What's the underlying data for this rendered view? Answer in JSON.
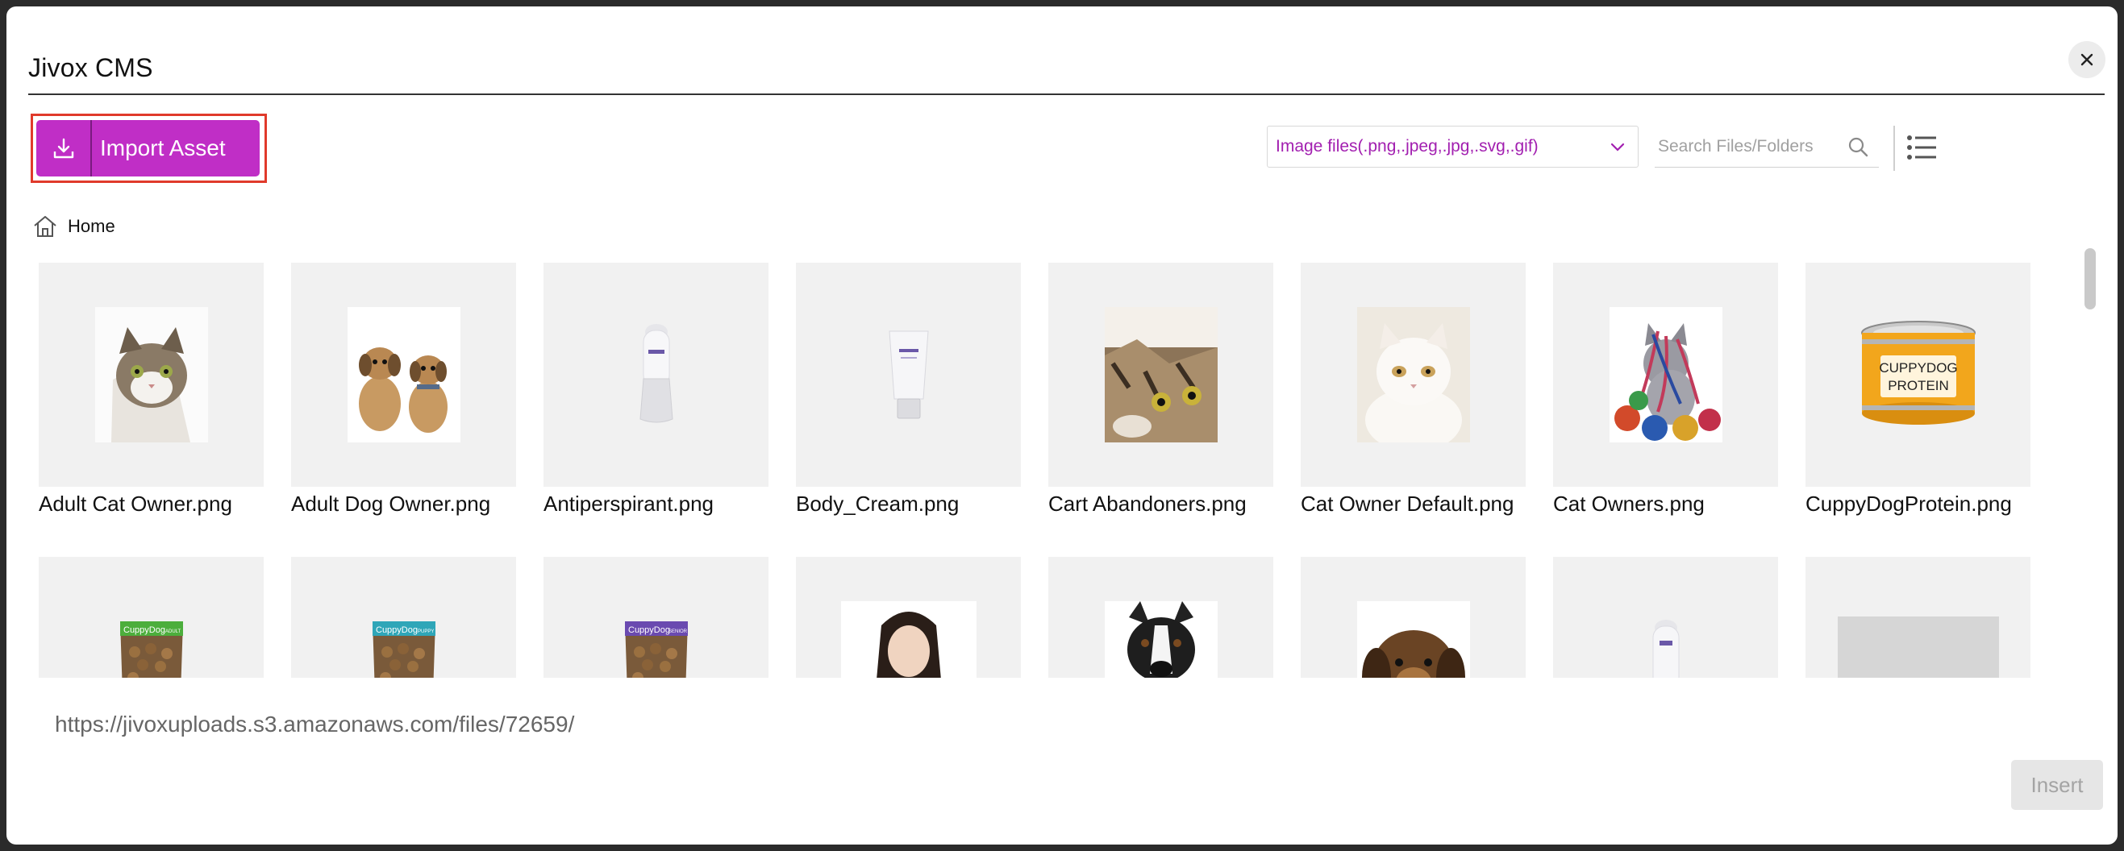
{
  "dialog": {
    "title": "Jivox CMS",
    "close_label": "×"
  },
  "toolbar": {
    "import_label": "Import Asset",
    "filter_value": "Image files(.png,.jpeg,.jpg,.svg,.gif)",
    "search_placeholder": "Search Files/Folders"
  },
  "breadcrumb": {
    "home_label": "Home"
  },
  "assets": [
    {
      "name": "Adult Cat Owner.png",
      "icon": "cat-photo"
    },
    {
      "name": "Adult Dog Owner.png",
      "icon": "dogs-photo"
    },
    {
      "name": "Antiperspirant.png",
      "icon": "antiperspirant-bottle"
    },
    {
      "name": "Body_Cream.png",
      "icon": "cream-tube"
    },
    {
      "name": "Cart Abandoners.png",
      "icon": "tabby-cat-photo"
    },
    {
      "name": "Cat Owner Default.png",
      "icon": "white-cat-photo"
    },
    {
      "name": "Cat Owners.png",
      "icon": "cat-with-yarn-photo"
    },
    {
      "name": "CuppyDogProtein.png",
      "icon": "dog-food-can"
    },
    {
      "name": "",
      "icon": "food-bag-green"
    },
    {
      "name": "",
      "icon": "food-bag-teal"
    },
    {
      "name": "",
      "icon": "food-bag-purple"
    },
    {
      "name": "",
      "icon": "woman-photo"
    },
    {
      "name": "",
      "icon": "dog-photo"
    },
    {
      "name": "",
      "icon": "puppy-photo"
    },
    {
      "name": "",
      "icon": "bottle"
    },
    {
      "name": "",
      "icon": "placeholder"
    }
  ],
  "can_label": {
    "line1": "CUPPYDOG",
    "line2": "PROTEIN"
  },
  "bag_brand": "CuppyDog",
  "bag_tags": [
    "ADULT",
    "PUPPY",
    "SENIOR"
  ],
  "footer": {
    "base_url": "https://jivoxuploads.s3.amazonaws.com/files/72659/",
    "insert_label": "Insert"
  },
  "colors": {
    "accent": "#c02ec6",
    "highlight": "#e03a2b",
    "filter_text": "#a21fb0"
  }
}
